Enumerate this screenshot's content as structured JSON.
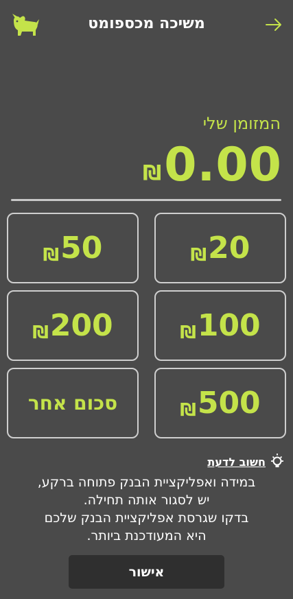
{
  "header": {
    "title": "משיכה מכספומט",
    "back_icon": "arrow-right-icon",
    "logo_icon": "dog-logo-icon"
  },
  "balance": {
    "label": "המזומן שלי",
    "amount": "0.00",
    "currency": "₪"
  },
  "amounts": [
    {
      "value": "20",
      "currency": "₪"
    },
    {
      "value": "50",
      "currency": "₪"
    },
    {
      "value": "100",
      "currency": "₪"
    },
    {
      "value": "200",
      "currency": "₪"
    },
    {
      "value": "500",
      "currency": "₪"
    }
  ],
  "other_amount_label": "סכום אחר",
  "notice": {
    "heading": "חשוב לדעת",
    "bulb_icon": "lightbulb-icon",
    "line1": "במידה ואפליקציית הבנק פתוחה ברקע,",
    "line2": "יש לסגור אותה תחילה.",
    "line3": "בדקו שגרסת אפליקציית הבנק שלכם",
    "line4": "היא המעודכנת ביותר."
  },
  "confirm_label": "אישור",
  "colors": {
    "background": "#4a4a4a",
    "accent": "#c4e34a",
    "button": "#2f2f2f"
  }
}
